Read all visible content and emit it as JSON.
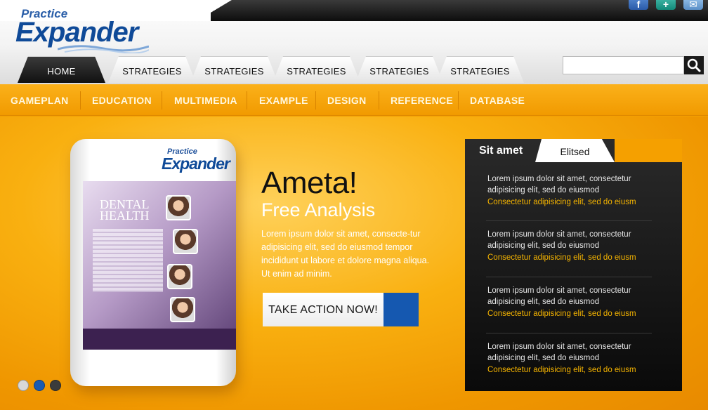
{
  "brand": {
    "top": "Practice",
    "main": "Expander"
  },
  "social": {
    "facebook": "f",
    "share": "+",
    "mail": "✉"
  },
  "tabs": [
    {
      "label": "HOME",
      "active": true
    },
    {
      "label": "STRATEGIES",
      "active": false
    },
    {
      "label": "STRATEGIES",
      "active": false
    },
    {
      "label": "STRATEGIES",
      "active": false
    },
    {
      "label": "STRATEGIES",
      "active": false
    },
    {
      "label": "STRATEGIES",
      "active": false
    }
  ],
  "search": {
    "value": "",
    "placeholder": "",
    "icon": "search-icon"
  },
  "nav": [
    "GAMEPLAN",
    "EDUCATION",
    "MULTIMEDIA",
    "EXAMPLE",
    "DESIGN",
    "REFERENCE",
    "DATABASE"
  ],
  "product": {
    "logo_top": "Practice",
    "logo_main": "Expander",
    "screen_title_1": "DENTAL",
    "screen_title_2": "HEALTH"
  },
  "hero": {
    "headline": "Ameta!",
    "subheadline": "Free Analysis",
    "lead": "Lorem ipsum dolor sit amet, consecte-tur adipisicing elit, sed do eiusmod tempor incididunt ut labore et dolore magna aliqua. Ut enim ad minim.",
    "cta": "TAKE ACTION NOW!"
  },
  "slider": {
    "count": 3,
    "active_index": 1
  },
  "panel": {
    "tab_active": "Sit amet",
    "tab_inactive": "Elitsed",
    "items": [
      {
        "text": "Lorem ipsum dolor sit amet, consectetur adipisicing elit, sed do eiusmod",
        "link": "Consectetur adipisicing elit, sed do eiusm"
      },
      {
        "text": "Lorem ipsum dolor sit amet, consectetur adipisicing elit, sed do eiusmod",
        "link": "Consectetur adipisicing elit, sed do eiusm"
      },
      {
        "text": "Lorem ipsum dolor sit amet, consectetur adipisicing elit, sed do eiusmod",
        "link": "Consectetur adipisicing elit, sed do eiusm"
      },
      {
        "text": "Lorem ipsum dolor sit amet, consectetur adipisicing elit, sed do eiusmod",
        "link": "Consectetur adipisicing elit, sed do eiusm"
      }
    ]
  },
  "colors": {
    "orange": "#f5a000",
    "brand_blue": "#0f4a98",
    "panel_link": "#f5b400",
    "cta_blue": "#1558b0"
  }
}
